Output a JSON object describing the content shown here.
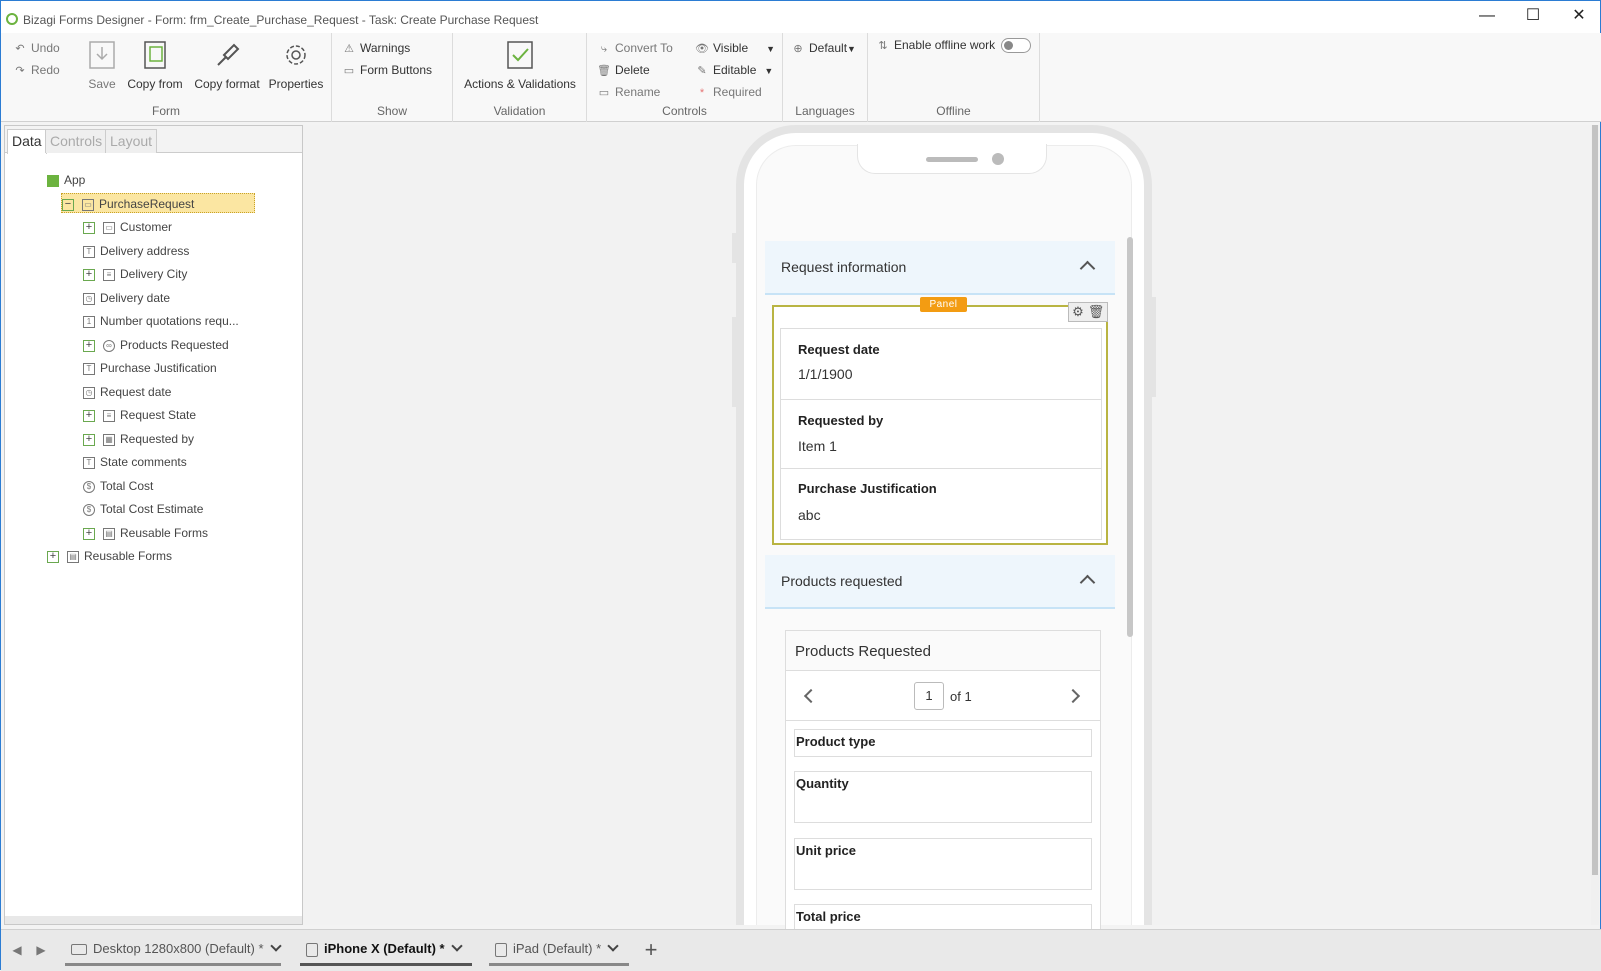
{
  "window": {
    "title": "Bizagi Forms Designer  - Form: frm_Create_Purchase_Request - Task:  Create Purchase Request",
    "minimize": "—",
    "maximize": "☐",
    "close": "✕"
  },
  "ribbon": {
    "form_group": {
      "label": "Form",
      "undo": "Undo",
      "redo": "Redo",
      "save": "Save",
      "copy_from": "Copy from",
      "copy_format": "Copy format",
      "properties": "Properties"
    },
    "show_group": {
      "label": "Show",
      "warnings": "Warnings",
      "form_buttons": "Form Buttons"
    },
    "validation_group": {
      "label": "Validation",
      "actions": "Actions & Validations"
    },
    "controls_group": {
      "label": "Controls",
      "convert_to": "Convert To",
      "delete": "Delete",
      "rename": "Rename",
      "visible": "Visible",
      "editable": "Editable",
      "required": "Required"
    },
    "languages_group": {
      "label": "Languages",
      "default": "Default"
    },
    "offline_group": {
      "label": "Offline",
      "enable": "Enable offline work"
    }
  },
  "left_panel": {
    "tabs": [
      "Data",
      "Controls",
      "Layout"
    ],
    "tree": {
      "app": "App",
      "purchase_request": "PurchaseRequest",
      "items": [
        "Customer",
        "Delivery address",
        "Delivery City",
        "Delivery date",
        "Number quotations requ...",
        "Products Requested",
        "Purchase Justification",
        "Request date",
        "Request State",
        "Requested by",
        "State comments",
        "Total Cost",
        "Total Cost Estimate",
        "Reusable Forms"
      ],
      "reusable_forms": "Reusable Forms"
    }
  },
  "form": {
    "section1": {
      "title": "Request information"
    },
    "panel_tag": "Panel",
    "fields": [
      {
        "label": "Request date",
        "value": "1/1/1900"
      },
      {
        "label": "Requested by",
        "value": "Item 1"
      },
      {
        "label": "Purchase Justification",
        "value": "abc"
      }
    ],
    "section2": {
      "title": "Products requested"
    },
    "grid": {
      "title": "Products Requested",
      "page": "1",
      "of": "of 1",
      "columns": [
        "Product type",
        "Quantity",
        "Unit price",
        "Total price"
      ]
    }
  },
  "bottom_tabs": [
    {
      "label": "Desktop 1280x800 (Default) *"
    },
    {
      "label": "iPhone X (Default) *"
    },
    {
      "label": "iPad (Default) *"
    }
  ],
  "colors": {
    "accent_green": "#6cb33f",
    "panel_tag": "#f39c12",
    "selection": "#fbe6a2"
  }
}
